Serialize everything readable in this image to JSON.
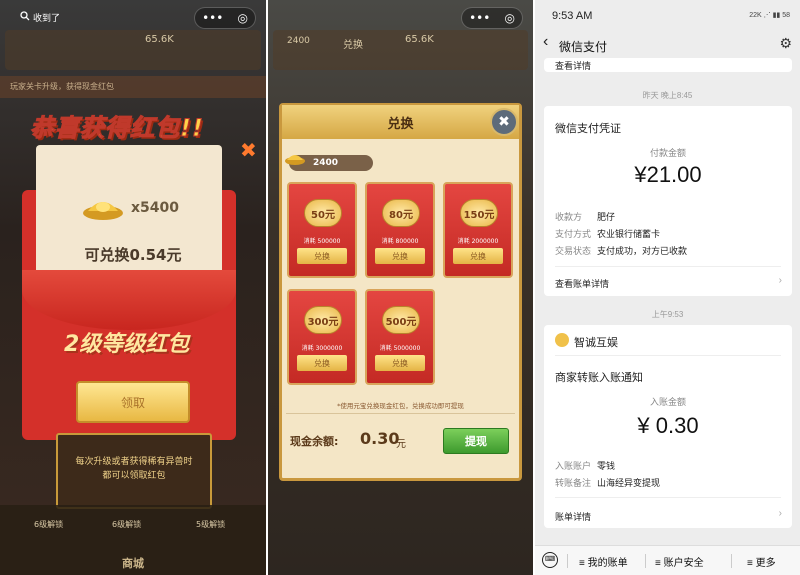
{
  "panel1": {
    "collapse_label": "收到了",
    "capsule_dots": "•••",
    "capsule_target": "◎",
    "hud_number": "65.6K",
    "banner_text": "玩家关卡升级，获得现金红包",
    "title": "恭喜获得红包!!",
    "ingot_count": "x5400",
    "redeem_text": "可兑换0.54元",
    "level_label": "2级等级红包",
    "claim_label": "领取",
    "tip_line1": "每次升级或者获得稀有异兽时",
    "tip_line2": "都可以领取红包",
    "bottom_items": [
      "6级解锁",
      "6级解锁",
      "5级解锁"
    ],
    "shop_label": "商城",
    "close_glyph": "✖"
  },
  "panel2": {
    "capsule_dots": "•••",
    "capsule_target": "◎",
    "hud_number": "65.6K",
    "hud_left": "2400",
    "hud_tab": "兑换",
    "title": "兑换",
    "close_glyph": "✖",
    "balance": "2400",
    "tiles": [
      {
        "value": "50元",
        "cost_label": "消耗",
        "cost": "500000",
        "button": "兑换"
      },
      {
        "value": "80元",
        "cost_label": "消耗",
        "cost": "800000",
        "button": "兑换"
      },
      {
        "value": "150元",
        "cost_label": "消耗",
        "cost": "2000000",
        "button": "兑换"
      },
      {
        "value": "300元",
        "cost_label": "消耗",
        "cost": "3000000",
        "button": "兑换"
      },
      {
        "value": "500元",
        "cost_label": "消耗",
        "cost": "5000000",
        "button": "兑换"
      }
    ],
    "note": "*使用元宝兑换现金红包，兑换成功即可提现",
    "cash_label": "现金余额:",
    "cash_value": "0.30",
    "cash_unit": "元",
    "withdraw_label": "提现"
  },
  "panel3": {
    "status": {
      "time": "9:53 AM",
      "icons": "22K ⋰ ▮▮ 58"
    },
    "nav": {
      "back": "‹",
      "title": "微信支付",
      "gear": "⚙"
    },
    "top_link": "查看详情",
    "ts1": "昨天 晚上8:45",
    "voucher": {
      "title": "微信支付凭证",
      "amount_label": "付款金额",
      "amount": "¥21.00",
      "rows": [
        {
          "key": "收款方",
          "value": "肥仔"
        },
        {
          "key": "支付方式",
          "value": "农业银行储蓄卡"
        },
        {
          "key": "交易状态",
          "value": "支付成功，对方已收款"
        }
      ],
      "link": "查看账单详情"
    },
    "ts2": "上午9:53",
    "merchant": {
      "name": "智诚互娱",
      "title": "商家转账入账通知",
      "amount_label": "入账金额",
      "amount": "¥ 0.30",
      "rows": [
        {
          "key": "入账账户",
          "value": "零钱"
        },
        {
          "key": "转账备注",
          "value": "山海经异变提现"
        }
      ],
      "link": "账单详情"
    },
    "bottom": {
      "keyboard": "⌨",
      "item1": "≡ 我的账单",
      "item2": "≡ 账户安全",
      "item3": "≡ 更多"
    }
  }
}
